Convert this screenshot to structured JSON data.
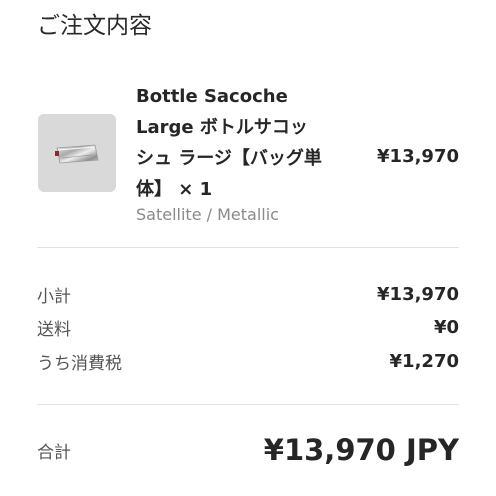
{
  "order": {
    "title": "ご注文内容"
  },
  "item": {
    "name_lines": [
      "Bottle Sacoche",
      "Large ボトルサコッ",
      "シュ ラージ【バッグ単",
      "体】 × 1"
    ],
    "variant": "Satellite / Metallic",
    "price": "¥13,970",
    "image_icon": "metallic-bag-thumbnail",
    "thumb_bg": "#d9d9d9"
  },
  "summary": {
    "subtotal_label": "小計",
    "subtotal_value": "¥13,970",
    "shipping_label": "送料",
    "shipping_value": "¥0",
    "tax_label": "うち消費税",
    "tax_value": "¥1,270"
  },
  "total": {
    "label": "合計",
    "value": "¥13,970 JPY"
  },
  "colors": {
    "text": "#262626",
    "muted": "#8a8a8a",
    "divider": "#e2e2e2"
  }
}
